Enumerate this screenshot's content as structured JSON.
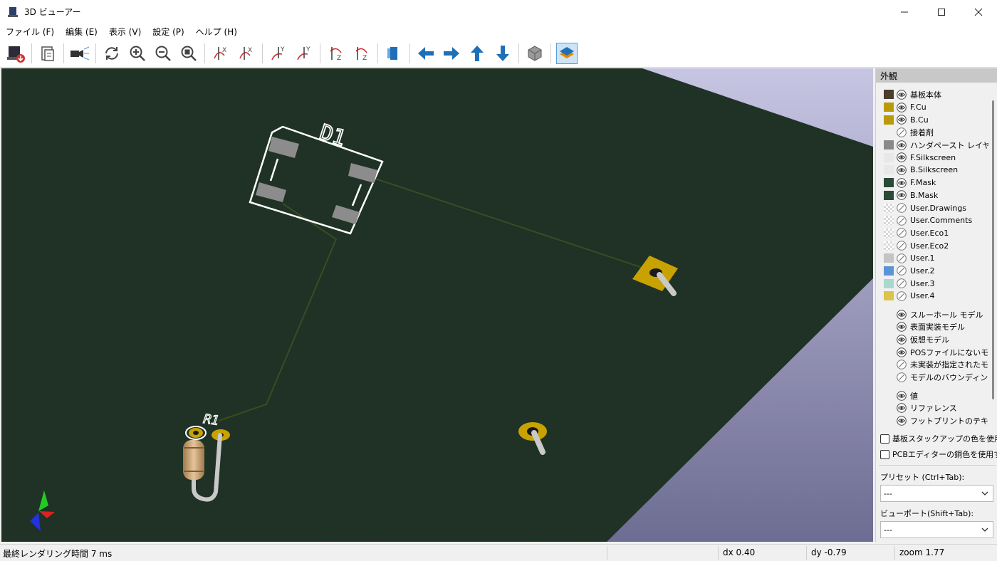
{
  "window": {
    "title": "3D ビューアー",
    "minimize": "—",
    "maximize": "☐",
    "close": "✕"
  },
  "menu": [
    "ファイル (F)",
    "編集 (E)",
    "表示 (V)",
    "設定 (P)",
    "ヘルプ (H)"
  ],
  "toolbar": {
    "buttons": [
      "export-image",
      "copy-clipboard",
      "raytrace",
      "reload",
      "zoom-in",
      "zoom-out",
      "zoom-fit",
      "rotate-x-cw",
      "rotate-x-ccw",
      "rotate-y-cw",
      "rotate-y-ccw",
      "rotate-z-cw",
      "rotate-z-ccw",
      "flip-board",
      "pan-left",
      "pan-right",
      "pan-up",
      "pan-down",
      "orthographic",
      "layers-toggle"
    ]
  },
  "viewport": {
    "board_color": "#1f3225",
    "background_color": "#b9b7d6",
    "silk_color": "#ffffff",
    "copper_color": "#c8a200",
    "d1_label": "D1",
    "r1_label": "R1"
  },
  "panel": {
    "title": "外観",
    "layers": [
      {
        "label": "基板本体",
        "color": "#4a3d2a",
        "visible": true
      },
      {
        "label": "F.Cu",
        "color": "#b89a0a",
        "visible": true
      },
      {
        "label": "B.Cu",
        "color": "#b89a0a",
        "visible": true
      },
      {
        "label": "接着剤",
        "color": "none",
        "visible": false
      },
      {
        "label": "ハンダペースト レイヤー",
        "color": "#8a8a8a",
        "visible": true
      },
      {
        "label": "F.Silkscreen",
        "color": "#e8e8e8",
        "visible": true
      },
      {
        "label": "B.Silkscreen",
        "color": "#e8e8e8",
        "visible": true
      },
      {
        "label": "F.Mask",
        "color": "#2a4a38",
        "visible": true
      },
      {
        "label": "B.Mask",
        "color": "#2a4a38",
        "visible": true
      },
      {
        "label": "User.Drawings",
        "color": "checker",
        "visible": false
      },
      {
        "label": "User.Comments",
        "color": "checker",
        "visible": false
      },
      {
        "label": "User.Eco1",
        "color": "checker",
        "visible": false
      },
      {
        "label": "User.Eco2",
        "color": "checker",
        "visible": false
      },
      {
        "label": "User.1",
        "color": "#c4c4c4",
        "visible": false
      },
      {
        "label": "User.2",
        "color": "#5b93d8",
        "visible": false
      },
      {
        "label": "User.3",
        "color": "#a9d8d0",
        "visible": false
      },
      {
        "label": "User.4",
        "color": "#dcc44a",
        "visible": false
      }
    ],
    "models": [
      {
        "label": "スルーホール モデル",
        "visible": true
      },
      {
        "label": "表面実装モデル",
        "visible": true
      },
      {
        "label": "仮想モデル",
        "visible": true
      },
      {
        "label": "POSファイルにないモデル",
        "visible": true
      },
      {
        "label": "未実装が指定されたモデル",
        "visible": false
      },
      {
        "label": "モデルのバウンディングボックス",
        "visible": false
      }
    ],
    "texts": [
      {
        "label": "値",
        "visible": true
      },
      {
        "label": "リファレンス",
        "visible": true
      },
      {
        "label": "フットプリントのテキスト",
        "visible": true
      }
    ],
    "use_stackup_colors": "基板スタックアップの色を使用",
    "use_pcb_copper_colors": "PCBエディターの銅色を使用する",
    "preset_label": "プリセット (Ctrl+Tab):",
    "preset_value": "---",
    "viewport_label": "ビューポート(Shift+Tab):",
    "viewport_value": "---"
  },
  "status": {
    "render_time": "最終レンダリング時間 7 ms",
    "dx": "dx 0.40",
    "dy": "dy -0.79",
    "zoom": "zoom 1.77"
  }
}
